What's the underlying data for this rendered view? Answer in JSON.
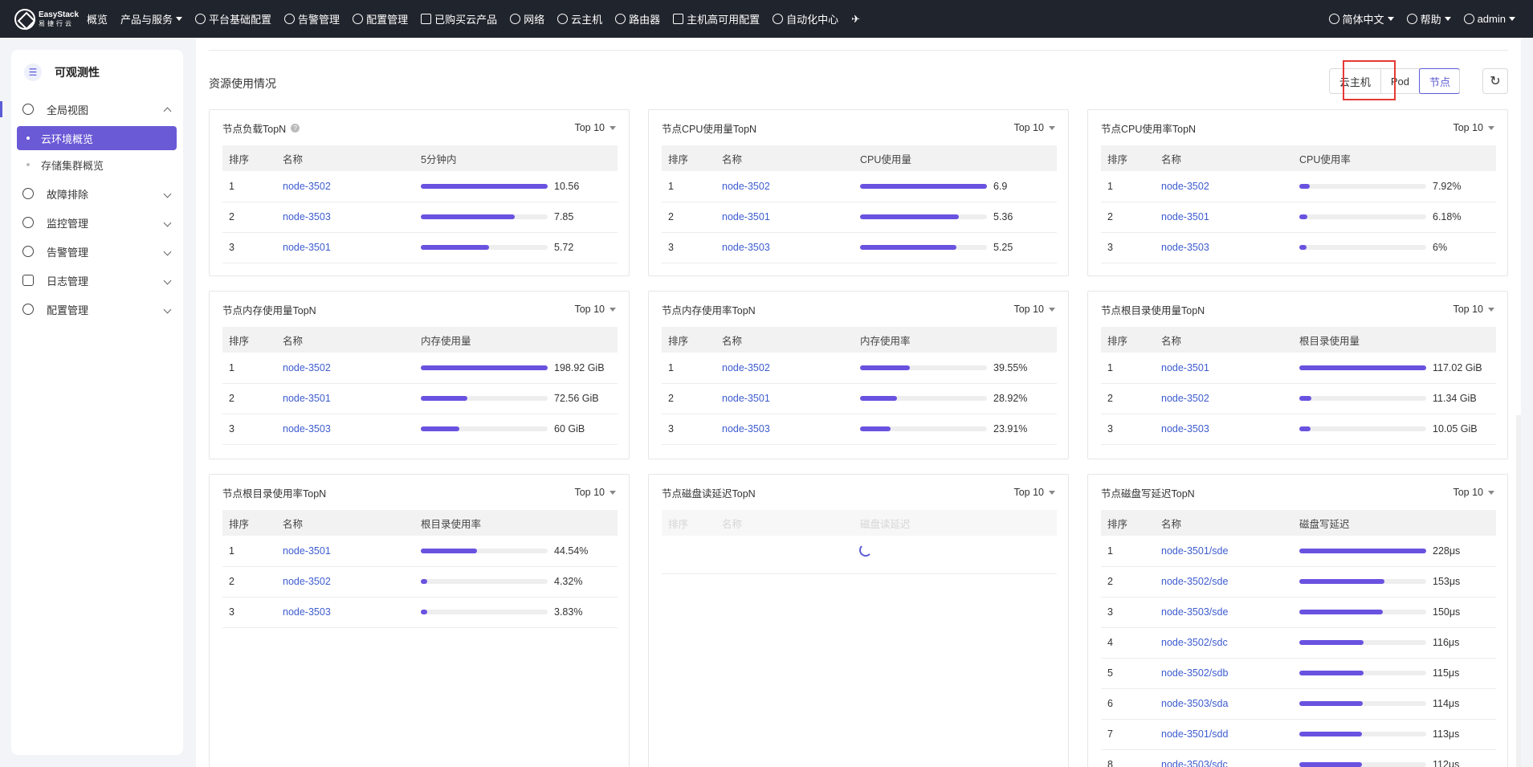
{
  "topbar": {
    "logo_en": "EasyStack",
    "logo_cn": "易捷行云",
    "nav": [
      {
        "label": "概览",
        "icon": "",
        "caret": false
      },
      {
        "label": "产品与服务",
        "icon": "",
        "caret": true
      },
      {
        "label": "平台基础配置",
        "icon": "gear-icon",
        "caret": false
      },
      {
        "label": "告警管理",
        "icon": "bell-icon",
        "caret": false
      },
      {
        "label": "配置管理",
        "icon": "gear-icon",
        "caret": false
      },
      {
        "label": "已购买云产品",
        "icon": "list-icon",
        "caret": false
      },
      {
        "label": "网络",
        "icon": "network-icon",
        "caret": false
      },
      {
        "label": "云主机",
        "icon": "cloud-icon",
        "caret": false
      },
      {
        "label": "路由器",
        "icon": "router-icon",
        "caret": false
      },
      {
        "label": "主机高可用配置",
        "icon": "host-icon",
        "caret": false
      },
      {
        "label": "自动化中心",
        "icon": "automation-icon",
        "caret": false
      }
    ],
    "pin_icon": "pin-icon",
    "language": "简体中文",
    "help": "帮助",
    "user": "admin"
  },
  "sidebar": {
    "title": "可观测性",
    "groups": [
      {
        "label": "全局视图",
        "icon": "globe-icon",
        "open": true,
        "children": [
          {
            "label": "云环境概览",
            "active": true
          },
          {
            "label": "存储集群概览",
            "active": false
          }
        ]
      },
      {
        "label": "故障排除",
        "icon": "search-icon",
        "open": false,
        "children": []
      },
      {
        "label": "监控管理",
        "icon": "monitor-icon",
        "open": false,
        "children": []
      },
      {
        "label": "告警管理",
        "icon": "bell-icon",
        "open": false,
        "children": []
      },
      {
        "label": "日志管理",
        "icon": "log-icon",
        "open": false,
        "children": []
      },
      {
        "label": "配置管理",
        "icon": "gear-icon",
        "open": false,
        "children": []
      }
    ]
  },
  "main": {
    "section_title": "资源使用情况",
    "segments": [
      {
        "label": "云主机",
        "active": false
      },
      {
        "label": "Pod",
        "active": false
      },
      {
        "label": "节点",
        "active": true
      }
    ],
    "colors": {
      "accent": "#5b5bd6",
      "bar": "#6a52e0",
      "link": "#3d5ccf",
      "highlight": "#e53935"
    }
  },
  "cards": [
    {
      "title": "节点负载TopN",
      "help": true,
      "top": "Top 10",
      "headers": [
        "排序",
        "名称",
        "5分钟内"
      ],
      "loading": false,
      "rows": [
        {
          "rank": "1",
          "name": "node-3502",
          "value": "10.56",
          "pct": 1.0
        },
        {
          "rank": "2",
          "name": "node-3503",
          "value": "7.85",
          "pct": 0.74
        },
        {
          "rank": "3",
          "name": "node-3501",
          "value": "5.72",
          "pct": 0.54
        }
      ]
    },
    {
      "title": "节点CPU使用量TopN",
      "help": false,
      "top": "Top 10",
      "headers": [
        "排序",
        "名称",
        "CPU使用量"
      ],
      "loading": false,
      "rows": [
        {
          "rank": "1",
          "name": "node-3502",
          "value": "6.9",
          "pct": 1.0
        },
        {
          "rank": "2",
          "name": "node-3501",
          "value": "5.36",
          "pct": 0.78
        },
        {
          "rank": "3",
          "name": "node-3503",
          "value": "5.25",
          "pct": 0.76
        }
      ]
    },
    {
      "title": "节点CPU使用率TopN",
      "help": false,
      "top": "Top 10",
      "headers": [
        "排序",
        "名称",
        "CPU使用率"
      ],
      "loading": false,
      "rows": [
        {
          "rank": "1",
          "name": "node-3502",
          "value": "7.92%",
          "pct": 0.0792
        },
        {
          "rank": "2",
          "name": "node-3501",
          "value": "6.18%",
          "pct": 0.0618
        },
        {
          "rank": "3",
          "name": "node-3503",
          "value": "6%",
          "pct": 0.06
        }
      ]
    },
    {
      "title": "节点内存使用量TopN",
      "help": false,
      "top": "Top 10",
      "headers": [
        "排序",
        "名称",
        "内存使用量"
      ],
      "loading": false,
      "rows": [
        {
          "rank": "1",
          "name": "node-3502",
          "value": "198.92 GiB",
          "pct": 1.0
        },
        {
          "rank": "2",
          "name": "node-3501",
          "value": "72.56 GiB",
          "pct": 0.365
        },
        {
          "rank": "3",
          "name": "node-3503",
          "value": "60 GiB",
          "pct": 0.302
        }
      ]
    },
    {
      "title": "节点内存使用率TopN",
      "help": false,
      "top": "Top 10",
      "headers": [
        "排序",
        "名称",
        "内存使用率"
      ],
      "loading": false,
      "rows": [
        {
          "rank": "1",
          "name": "node-3502",
          "value": "39.55%",
          "pct": 0.3955
        },
        {
          "rank": "2",
          "name": "node-3501",
          "value": "28.92%",
          "pct": 0.2892
        },
        {
          "rank": "3",
          "name": "node-3503",
          "value": "23.91%",
          "pct": 0.2391
        }
      ]
    },
    {
      "title": "节点根目录使用量TopN",
      "help": false,
      "top": "Top 10",
      "headers": [
        "排序",
        "名称",
        "根目录使用量"
      ],
      "loading": false,
      "rows": [
        {
          "rank": "1",
          "name": "node-3501",
          "value": "117.02 GiB",
          "pct": 1.0
        },
        {
          "rank": "2",
          "name": "node-3502",
          "value": "11.34 GiB",
          "pct": 0.097
        },
        {
          "rank": "3",
          "name": "node-3503",
          "value": "10.05 GiB",
          "pct": 0.086
        }
      ]
    },
    {
      "title": "节点根目录使用率TopN",
      "help": false,
      "top": "Top 10",
      "headers": [
        "排序",
        "名称",
        "根目录使用率"
      ],
      "loading": false,
      "rows": [
        {
          "rank": "1",
          "name": "node-3501",
          "value": "44.54%",
          "pct": 0.4454
        },
        {
          "rank": "2",
          "name": "node-3502",
          "value": "4.32%",
          "pct": 0.0432
        },
        {
          "rank": "3",
          "name": "node-3503",
          "value": "3.83%",
          "pct": 0.0383
        }
      ]
    },
    {
      "title": "节点磁盘读延迟TopN",
      "help": false,
      "top": "Top 10",
      "headers": [
        "排序",
        "名称",
        "磁盘读延迟"
      ],
      "loading": true,
      "rows": []
    },
    {
      "title": "节点磁盘写延迟TopN",
      "help": false,
      "top": "Top 10",
      "headers": [
        "排序",
        "名称",
        "磁盘写延迟"
      ],
      "loading": false,
      "rows": [
        {
          "rank": "1",
          "name": "node-3501/sde",
          "value": "228μs",
          "pct": 1.0
        },
        {
          "rank": "2",
          "name": "node-3502/sde",
          "value": "153μs",
          "pct": 0.671
        },
        {
          "rank": "3",
          "name": "node-3503/sde",
          "value": "150μs",
          "pct": 0.658
        },
        {
          "rank": "4",
          "name": "node-3502/sdc",
          "value": "116μs",
          "pct": 0.509
        },
        {
          "rank": "5",
          "name": "node-3502/sdb",
          "value": "115μs",
          "pct": 0.504
        },
        {
          "rank": "6",
          "name": "node-3503/sda",
          "value": "114μs",
          "pct": 0.5
        },
        {
          "rank": "7",
          "name": "node-3501/sdd",
          "value": "113μs",
          "pct": 0.496
        },
        {
          "rank": "8",
          "name": "node-3503/sdc",
          "value": "112μs",
          "pct": 0.491
        }
      ]
    }
  ]
}
